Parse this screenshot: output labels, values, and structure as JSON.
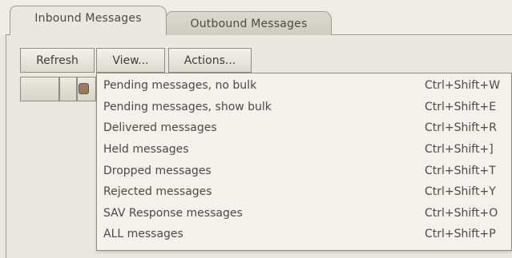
{
  "tabs": [
    {
      "label": "Inbound Messages",
      "active": true
    },
    {
      "label": "Outbound Messages",
      "active": false
    }
  ],
  "toolbar": {
    "refresh_label": "Refresh",
    "view_label": "View...",
    "actions_label": "Actions..."
  },
  "status_icon": {
    "name": "status-indicator-icon",
    "colors": [
      "#d8644e",
      "#6a8f5a"
    ]
  },
  "view_menu": {
    "items": [
      {
        "label": "Pending messages, no bulk",
        "shortcut": "Ctrl+Shift+W"
      },
      {
        "label": "Pending messages, show bulk",
        "shortcut": "Ctrl+Shift+E"
      },
      {
        "label": "Delivered messages",
        "shortcut": "Ctrl+Shift+R"
      },
      {
        "label": "Held messages",
        "shortcut": "Ctrl+Shift+]"
      },
      {
        "label": "Dropped messages",
        "shortcut": "Ctrl+Shift+T"
      },
      {
        "label": "Rejected messages",
        "shortcut": "Ctrl+Shift+Y"
      },
      {
        "label": "SAV Response messages",
        "shortcut": "Ctrl+Shift+O"
      },
      {
        "label": "ALL messages",
        "shortcut": "Ctrl+Shift+P"
      }
    ]
  }
}
